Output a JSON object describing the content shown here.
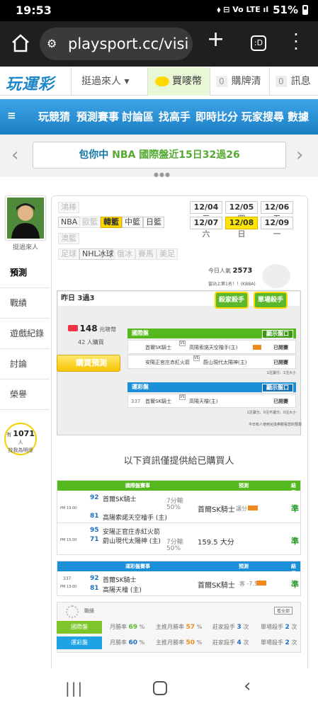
{
  "status": {
    "time": "19:53",
    "battery": "51%",
    "icons": "⬧ ⊟ Vo LTE ıl"
  },
  "browser": {
    "url": "playsport.cc/visi",
    "tab_count": ":D"
  },
  "site": {
    "logo": "玩運彩",
    "user_menu": "挺過來人 ▾",
    "buy": "買嘜幣",
    "cart_count": "0",
    "cart": "購牌清單",
    "msg_count": "0",
    "msg": "訊息"
  },
  "nav": [
    "玩競猜",
    "預測賽事",
    "討論區",
    "找高手",
    "即時比分",
    "玩家搜尋",
    "數據"
  ],
  "banner": {
    "prefix": "包你中",
    "league": "NBA",
    "text": "國際盤近15日32過26"
  },
  "profile": {
    "name": "挺過來人"
  },
  "side": [
    "預測",
    "戰績",
    "遊戲紀錄",
    "討論",
    "榮譽"
  ],
  "bulb": {
    "pre": "有",
    "count": "1071",
    "unit": "人",
    "text": "找我為明燈"
  },
  "sports": {
    "row1": [
      "鴻棒",
      "NBA",
      "歐籃",
      "韓籃",
      "中籃",
      "日籃"
    ],
    "row2": [
      "澳籃"
    ],
    "row3": [
      "足球",
      "NHL冰球",
      "俄冰",
      "賽馬",
      "美足"
    ]
  },
  "dates": [
    [
      "12/04",
      "三"
    ],
    [
      "12/05",
      "四"
    ],
    [
      "12/06",
      "五"
    ],
    [
      "12/07",
      "六"
    ],
    [
      "12/08",
      "日"
    ],
    [
      "12/09",
      "一"
    ]
  ],
  "popularity": {
    "label": "今日人氣",
    "value": "2573",
    "rank": "當站上第1名！！(KBBA)"
  },
  "yesterday": "昨日 3過3",
  "badges": [
    "殺家殺手",
    "單場殺手"
  ],
  "price": {
    "value": "148",
    "unit": "元嘜幣",
    "buyers": "42",
    "buyers_unit": "人購買",
    "button": "購買預測"
  },
  "intl": {
    "title": "國際盤",
    "btn": "顯示盤口",
    "rows": [
      [
        "首爾SK騎士",
        "VS",
        "高陽索諾天空檜手(主)",
        "已開賽"
      ],
      [
        "安陽正官庄赤紅火箭",
        "VS",
        "蔚山現代太陽神(主)",
        "已開賽"
      ]
    ],
    "foot": "1注讓分、1注大小"
  },
  "tw": {
    "title": "運彩盤",
    "btn": "顯示盤口",
    "rows": [
      [
        "337",
        "首爾SK騎士",
        "VS",
        "高陽天檜(主)",
        "已開賽"
      ]
    ],
    "foot": "1注讓分、0注不讓分、0注大小"
  },
  "pay_note": "今日有人使用兌換券觀看您的預測",
  "info_title": "以下資訊僅提供給已購買人",
  "tbl1": {
    "h": [
      "國際盤賽事",
      "預測",
      "結果"
    ],
    "games": [
      {
        "time": "PM 13:00",
        "lines": [
          [
            "92",
            "首爾SK騎士"
          ],
          [
            "81",
            "高陽索諾天空檜手 (主)"
          ]
        ],
        "spread": "7分輸",
        "pct": "50%",
        "pick": "首爾SK騎士",
        "pick_type": "讓分",
        "res": "準"
      },
      {
        "time": "PM 15:00",
        "lines": [
          [
            "95",
            "安陽正官庄赤紅火箭"
          ],
          [
            "71",
            "蔚山現代太陽神 (主)"
          ]
        ],
        "spread": "7分輸",
        "pct": "50%",
        "pick": "159.5 大分",
        "pick_type": "",
        "res": "準"
      }
    ]
  },
  "tbl2": {
    "h": [
      "運彩盤賽事",
      "預測",
      "結果"
    ],
    "game": {
      "no": "337",
      "time": "PM 13:00",
      "lines": [
        [
          "92",
          "首爾SK騎士"
        ],
        [
          "81",
          "高陽天檜 (主)"
        ]
      ],
      "pick": "首爾SK騎士",
      "pick_type": "客 -7.5",
      "res": "準"
    }
  },
  "record": {
    "title": "戰績",
    "btn": "看全部",
    "rows": [
      {
        "name": "國際盤",
        "month": "69",
        "main": "57",
        "kill": "3",
        "single": "2"
      },
      {
        "name": "運彩盤",
        "month": "60",
        "main": "50",
        "kill": "4",
        "single": "2"
      }
    ],
    "labels": [
      "月勝率",
      "主推月勝率",
      "莊家殺手",
      "單場殺手"
    ]
  },
  "colors": {
    "green": "#55b81e",
    "blue": "#1b8fd8",
    "yellow": "#ffe600"
  }
}
